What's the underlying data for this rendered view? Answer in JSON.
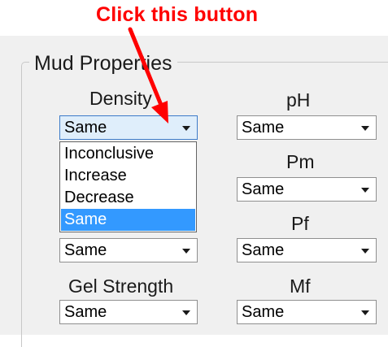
{
  "callout": {
    "text": "Click this button",
    "color": "#ff0000"
  },
  "group": {
    "title": "Mud Properties"
  },
  "fields": {
    "density": {
      "label": "Density",
      "value": "Same"
    },
    "ph": {
      "label": "pH",
      "value": "Same"
    },
    "pm": {
      "label": "Pm",
      "value": "Same"
    },
    "pf": {
      "label": "Pf",
      "value": "Same"
    },
    "left_row3": {
      "value": "Same"
    },
    "gel_strength": {
      "label": "Gel Strength",
      "value": "Same"
    },
    "mf": {
      "label": "Mf",
      "value": "Same"
    }
  },
  "dropdown": {
    "options": [
      "Inconclusive",
      "Increase",
      "Decrease",
      "Same"
    ],
    "selected": "Same",
    "highlight_color": "#3399ff"
  },
  "icons": {
    "combo_arrow": "chevron-down-icon",
    "callout_arrow": "red-arrow-icon"
  }
}
